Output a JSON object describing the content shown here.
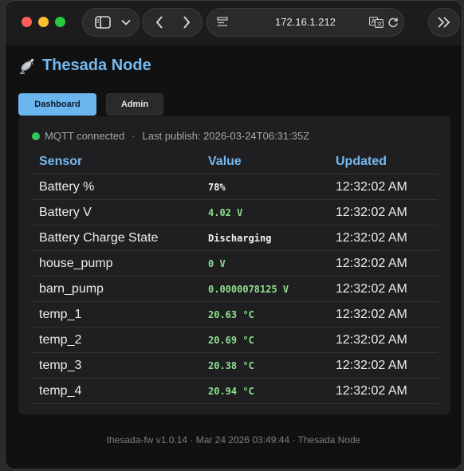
{
  "browser": {
    "address": "172.16.1.212",
    "icons": [
      "sidebar-toggle-icon",
      "chevron-down-icon",
      "back-arrow-icon",
      "forward-arrow-icon",
      "page-menu-icon",
      "translate-icon",
      "reload-icon",
      "double-chevron-right-icon"
    ]
  },
  "app": {
    "title": "Thesada Node",
    "title_icon": "satellite-antenna-icon"
  },
  "tabs": [
    {
      "label": "Dashboard",
      "active": true
    },
    {
      "label": "Admin",
      "active": false
    }
  ],
  "status": {
    "mqtt": "MQTT connected",
    "separator": "·",
    "last_publish": "Last publish: 2026-03-24T06:31:35Z",
    "color": "#34c759"
  },
  "table": {
    "headers": [
      "Sensor",
      "Value",
      "Updated"
    ],
    "rows": [
      {
        "sensor": "Battery %",
        "value": "78%",
        "updated": "12:32:02 AM",
        "color": "white"
      },
      {
        "sensor": "Battery V",
        "value": "4.02 V",
        "updated": "12:32:02 AM",
        "color": "green"
      },
      {
        "sensor": "Battery Charge State",
        "value": "Discharging",
        "updated": "12:32:02 AM",
        "color": "white"
      },
      {
        "sensor": "house_pump",
        "value": "0 V",
        "updated": "12:32:02 AM",
        "color": "green"
      },
      {
        "sensor": "barn_pump",
        "value": "0.0000078125 V",
        "updated": "12:32:02 AM",
        "color": "green"
      },
      {
        "sensor": "temp_1",
        "value": "20.63 °C",
        "updated": "12:32:02 AM",
        "color": "green"
      },
      {
        "sensor": "temp_2",
        "value": "20.69 °C",
        "updated": "12:32:02 AM",
        "color": "green"
      },
      {
        "sensor": "temp_3",
        "value": "20.38 °C",
        "updated": "12:32:02 AM",
        "color": "green"
      },
      {
        "sensor": "temp_4",
        "value": "20.94 °C",
        "updated": "12:32:02 AM",
        "color": "green"
      }
    ]
  },
  "footer": "thesada-fw v1.0.14 · Mar 24 2026 03:49:44 · Thesada Node",
  "colors": {
    "accent": "#74b9f0",
    "value_green": "#8ee08e",
    "tab_active": "#6cb6f0"
  }
}
